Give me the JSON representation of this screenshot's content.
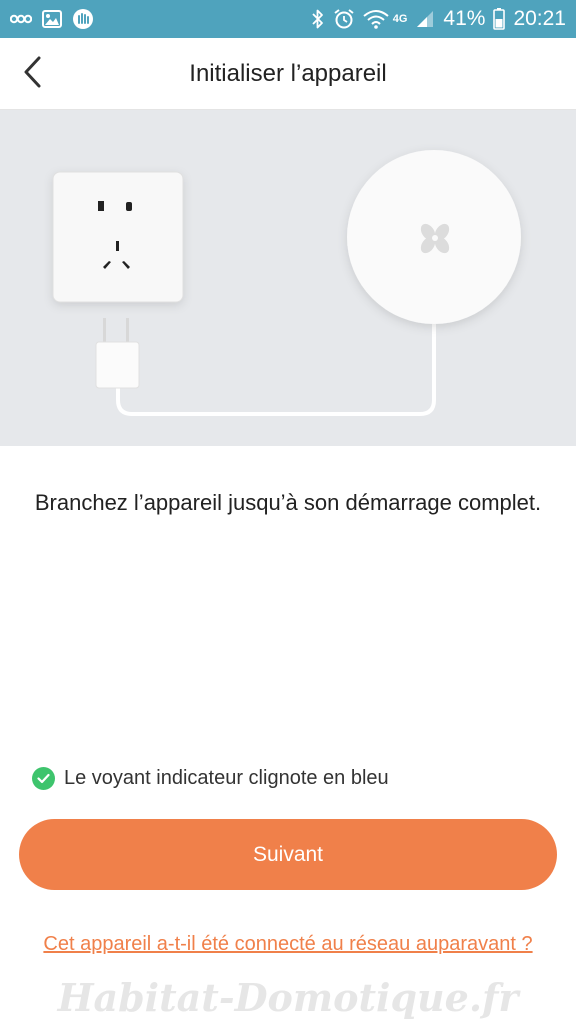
{
  "status_bar": {
    "battery": "41%",
    "time": "20:21",
    "network": "4G",
    "icons": [
      "voicemail-icon",
      "image-icon",
      "app-icon",
      "bluetooth-icon",
      "alarm-icon",
      "wifi-icon",
      "signal-icon",
      "battery-icon"
    ]
  },
  "header": {
    "title": "Initialiser l’appareil",
    "back_icon": "back-arrow-icon"
  },
  "illustration": {
    "items": [
      "power-socket",
      "usb-adapter",
      "hub-device",
      "cable"
    ],
    "hub_logo": "fan-logo-icon"
  },
  "instruction": "Branchez l’appareil jusqu’à son démarrage complet.",
  "indicator": {
    "label": "Le voyant indicateur clignote en bleu",
    "checked": true,
    "color": "#3ec46d"
  },
  "next_button": {
    "label": "Suivant",
    "color": "#f0804a"
  },
  "reset_link": "Cet appareil a-t-il été connecté au réseau auparavant ?",
  "watermark": "Habitat-Domotique.fr"
}
